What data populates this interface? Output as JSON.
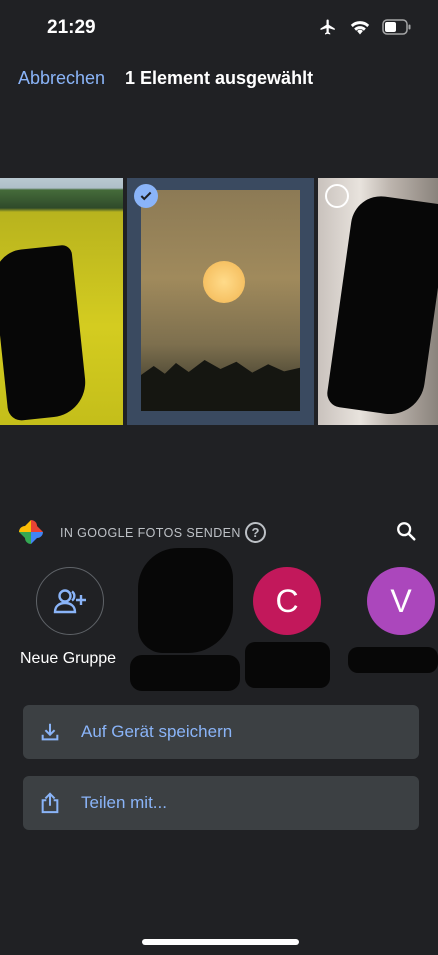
{
  "status_bar": {
    "time": "21:29",
    "icons": [
      "airplane-icon",
      "wifi-icon",
      "battery-icon"
    ]
  },
  "header": {
    "cancel_label": "Abbrechen",
    "title": "1 Element ausgewählt"
  },
  "photos": [
    {
      "description": "rapeseed-field",
      "selected": false
    },
    {
      "description": "sunset",
      "selected": true
    },
    {
      "description": "room-curtain",
      "selected": false
    }
  ],
  "send_section": {
    "label": "IN GOOGLE FOTOS SENDEN",
    "help_glyph": "?",
    "contacts": [
      {
        "initial": "",
        "label": "Neue Gruppe",
        "icon": "add-group-icon"
      },
      {
        "initial": "",
        "label": ""
      },
      {
        "initial": "C",
        "label": "",
        "color": "#c2185b"
      },
      {
        "initial": "V",
        "label": "",
        "color": "#ab47bc"
      }
    ]
  },
  "actions": {
    "save_label": "Auf Gerät speichern",
    "share_label": "Teilen mit..."
  },
  "colors": {
    "background": "#202124",
    "accent": "#8ab4f8",
    "button_bg": "#3c4043"
  }
}
